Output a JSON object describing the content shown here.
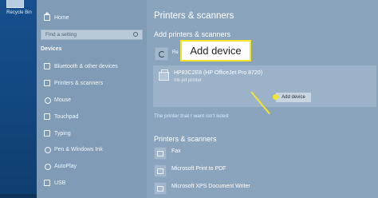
{
  "desktop": {
    "recycle_bin_label": "Recycle Bin"
  },
  "sidebar": {
    "home_label": "Home",
    "search_placeholder": "Find a setting",
    "section_label": "Devices",
    "items": [
      {
        "label": "Bluetooth & other devices",
        "icon": "bluetooth-icon"
      },
      {
        "label": "Printers & scanners",
        "icon": "printer-icon"
      },
      {
        "label": "Mouse",
        "icon": "mouse-icon"
      },
      {
        "label": "Touchpad",
        "icon": "touchpad-icon"
      },
      {
        "label": "Typing",
        "icon": "keyboard-icon"
      },
      {
        "label": "Pen & Windows Ink",
        "icon": "pen-icon"
      },
      {
        "label": "AutoPlay",
        "icon": "autoplay-icon"
      },
      {
        "label": "USB",
        "icon": "usb-icon"
      }
    ]
  },
  "main": {
    "title": "Printers & scanners",
    "add_heading": "Add printers & scanners",
    "refresh_label": "Re",
    "found_printer": {
      "name": "HP83C2E8 (HP OfficeJet Pro 8720)",
      "type": "Ink-jet printer"
    },
    "add_device_button": "Add device",
    "callout_label": "Add device",
    "not_listed_link": "The printer that I want isn't listed",
    "list_heading": "Printers & scanners",
    "printers": [
      {
        "name": "Fax"
      },
      {
        "name": "Microsoft Print to PDF"
      },
      {
        "name": "Microsoft XPS Document Writer"
      }
    ]
  },
  "colors": {
    "callout": "#f4e42a",
    "link": "#d8ebff"
  }
}
